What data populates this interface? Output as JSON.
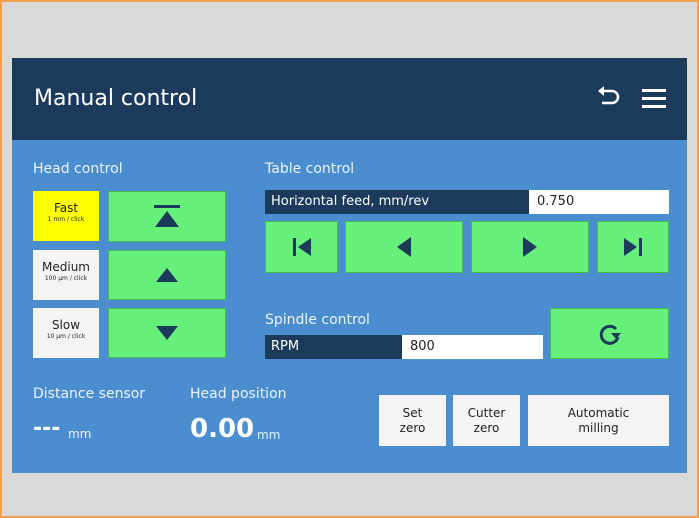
{
  "header": {
    "title": "Manual control"
  },
  "head_control": {
    "label": "Head control",
    "speeds": [
      {
        "name": "Fast",
        "sub": "1 mm / click",
        "active": true
      },
      {
        "name": "Medium",
        "sub": "100 µm / click",
        "active": false
      },
      {
        "name": "Slow",
        "sub": "10 µm / click",
        "active": false
      }
    ]
  },
  "table_control": {
    "label": "Table control",
    "feed_label": "Horizontal feed, mm/rev",
    "feed_value": "0.750"
  },
  "spindle_control": {
    "label": "Spindle control",
    "rpm_label": "RPM",
    "rpm_value": "800"
  },
  "readouts": {
    "distance_label": "Distance sensor",
    "distance_value": "---",
    "distance_unit": "mm",
    "position_label": "Head position",
    "position_value": "0.00",
    "position_unit": "mm"
  },
  "actions": {
    "set_zero_line1": "Set",
    "set_zero_line2": "zero",
    "cutter_zero_line1": "Cutter",
    "cutter_zero_line2": "zero",
    "auto_mill_line1": "Automatic",
    "auto_mill_line2": "milling"
  },
  "colors": {
    "header_bg": "#1b3a5c",
    "panel_bg": "#4a8ed0",
    "button_green": "#66f07a",
    "active_yellow": "#ffff00"
  },
  "icons": [
    "undo-icon",
    "menu-icon",
    "move-top-icon",
    "move-up-icon",
    "move-down-icon",
    "skip-start-icon",
    "step-left-icon",
    "step-right-icon",
    "skip-end-icon",
    "rotate-icon"
  ]
}
